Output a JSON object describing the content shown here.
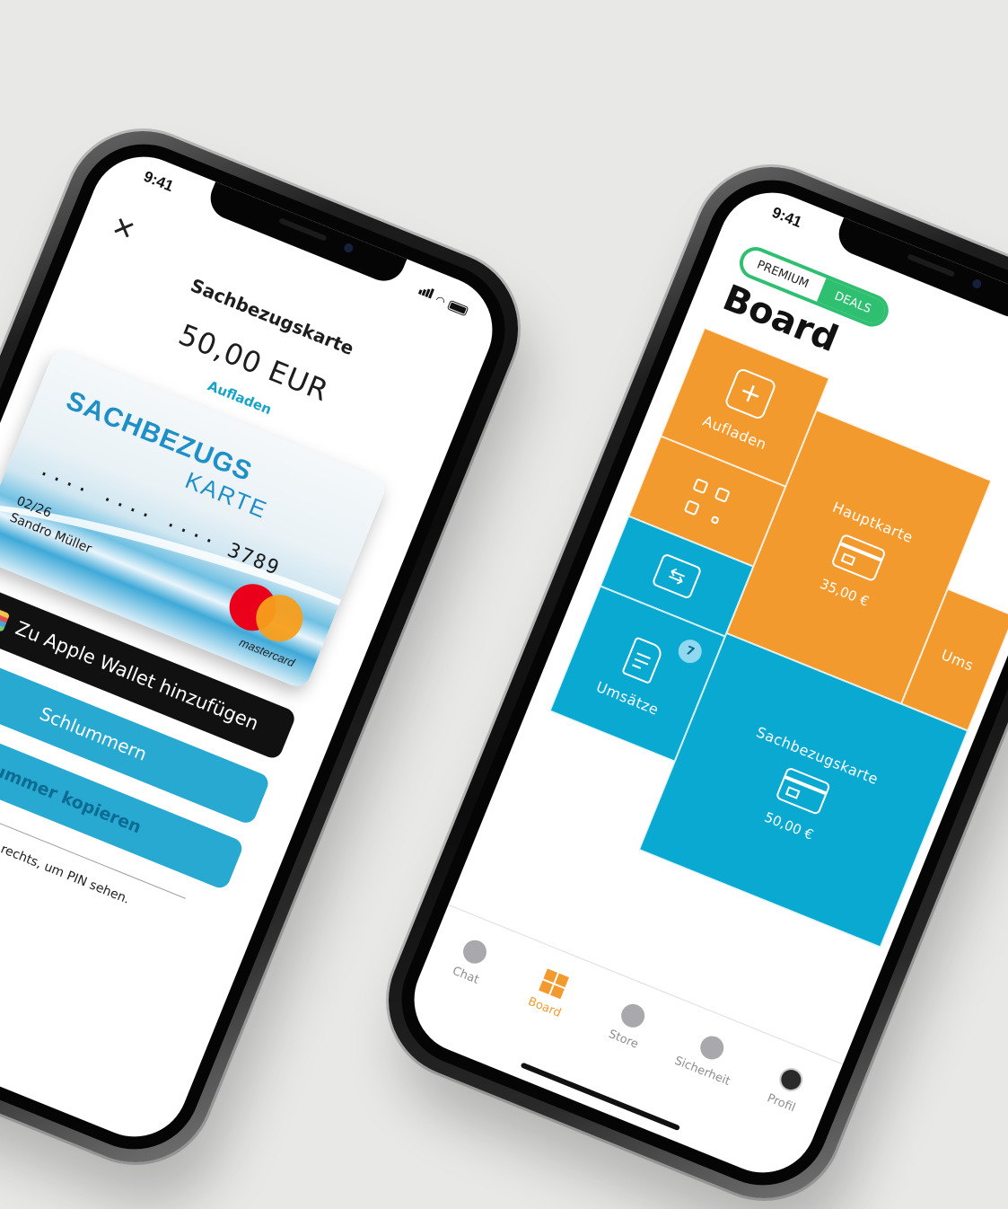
{
  "status": {
    "time": "9:41"
  },
  "card_screen": {
    "title": "Sachbezugskarte",
    "amount": "50,00 EUR",
    "topup_link": "Aufladen",
    "card": {
      "brand_line1": "SACHBEZUGS",
      "brand_line2": "KARTE",
      "number": "···· ···· ···· 3789",
      "expiry": "02/26",
      "holder": "Sandro Müller",
      "network": "mastercard"
    },
    "wallet_button": "Zu Apple Wallet hinzufügen",
    "snooze_button": "Schlummern",
    "copy_button": "ummer kopieren",
    "pin_hint": "ks und rechts, um PIN sehen."
  },
  "board_screen": {
    "pill_left": "PREMIUM",
    "pill_right": "DEALS",
    "title": "Board",
    "tiles": {
      "topup": {
        "label": "Aufladen",
        "icon": "plus-square-icon"
      },
      "scan": {
        "icon": "qr-scan-icon"
      },
      "main_card": {
        "label": "Hauptkarte",
        "amount": "35,00 €",
        "icon": "credit-card-icon"
      },
      "transfer": {
        "icon": "transfer-arrows-icon"
      },
      "transactions": {
        "label": "Umsätze",
        "badge": "7",
        "icon": "document-icon"
      },
      "benefit_card": {
        "label": "Sachbezugskarte",
        "amount": "50,00 €",
        "icon": "credit-card-icon"
      },
      "right_partial": {
        "label": "Ums"
      }
    },
    "tabs": [
      {
        "label": "Chat",
        "icon": "chat-bubble-icon"
      },
      {
        "label": "Board",
        "icon": "board-grid-icon"
      },
      {
        "label": "Store",
        "icon": "plus-circle-icon"
      },
      {
        "label": "Sicherheit",
        "icon": "key-icon"
      },
      {
        "label": "Profil",
        "icon": "avatar-icon"
      }
    ]
  },
  "colors": {
    "orange": "#f39a2e",
    "blue": "#0aa9d2",
    "green": "#2fbf71",
    "accent_text": "#1aa3c9"
  }
}
